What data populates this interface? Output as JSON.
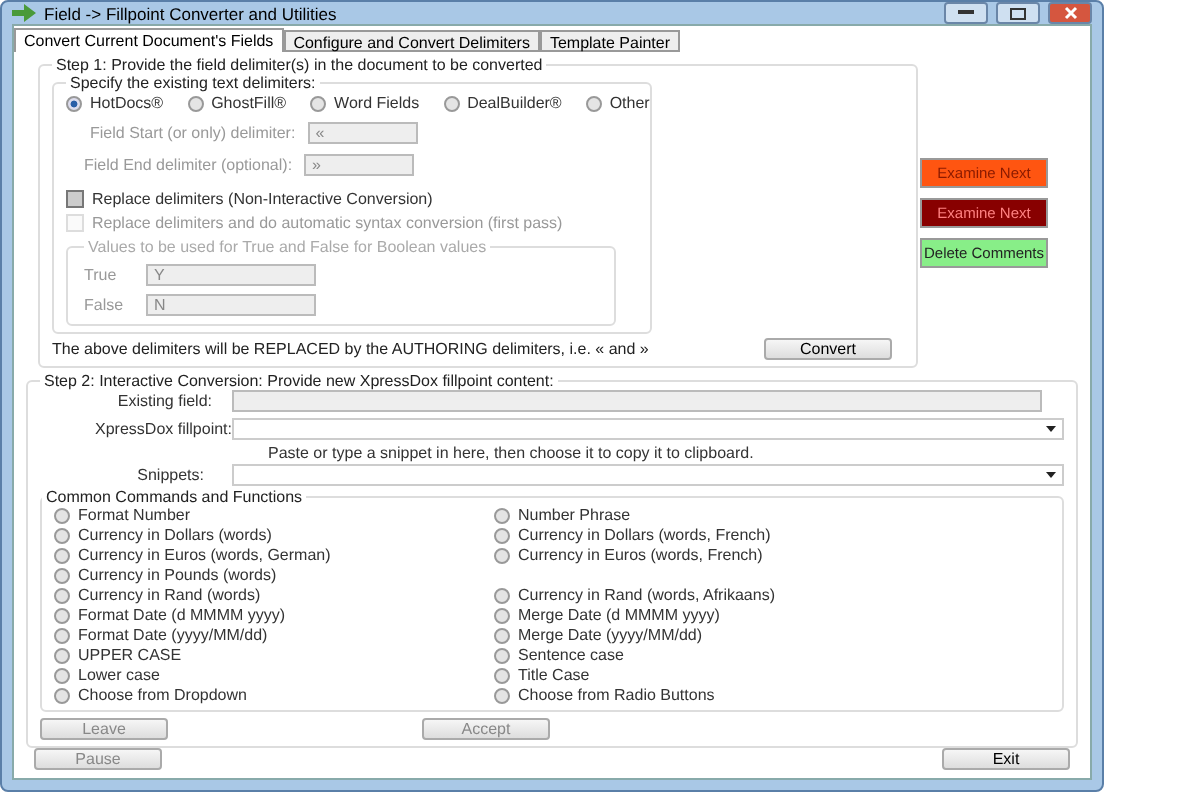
{
  "window": {
    "title": "Field -> Fillpoint Converter and Utilities"
  },
  "tabs": [
    {
      "label": "Convert Current Document's Fields",
      "selected": true
    },
    {
      "label": "Configure and Convert Delimiters",
      "selected": false
    },
    {
      "label": "Template Painter",
      "selected": false
    }
  ],
  "step1": {
    "legend": "Step 1: Provide the field delimiter(s) in the document to be converted",
    "delimiters": {
      "legend": "Specify the existing text delimiters:",
      "options": [
        {
          "label": "HotDocs®",
          "selected": true
        },
        {
          "label": "GhostFill®",
          "selected": false
        },
        {
          "label": "Word Fields",
          "selected": false
        },
        {
          "label": "DealBuilder®",
          "selected": false
        },
        {
          "label": "Other",
          "selected": false
        }
      ],
      "fields": [
        {
          "label": "Field Start (or only) delimiter:",
          "value": "«"
        },
        {
          "label": "Field End delimiter (optional):",
          "value": "»"
        }
      ]
    },
    "checkboxes": [
      {
        "label": "Replace delimiters (Non-Interactive Conversion)",
        "checked": false,
        "disabled": false
      },
      {
        "label": "Replace delimiters and do automatic syntax conversion (first pass)",
        "checked": false,
        "disabled": true
      }
    ],
    "booleans": {
      "legend": "Values to be used for True and False for Boolean values",
      "fields": [
        {
          "label": "True",
          "value": "Y"
        },
        {
          "label": "False",
          "value": "N"
        }
      ]
    },
    "note": "The above delimiters will be REPLACED by the AUTHORING delimiters, i.e. « and »",
    "convert": "Convert",
    "side_buttons": [
      {
        "label": "Examine Next",
        "color": "#ff5511"
      },
      {
        "label": "Examine Next",
        "color": "#880000"
      },
      {
        "label": "Delete Comments",
        "color": "#88ee88"
      }
    ]
  },
  "step2": {
    "legend": "Step 2: Interactive Conversion: Provide new XpressDox fillpoint content:",
    "existing_label": "Existing field:",
    "fillpoint_label": "XpressDox fillpoint:",
    "hint": "Paste or type a snippet in here, then choose it to copy it to clipboard.",
    "snippets_label": "Snippets:",
    "commands": {
      "legend": "Common Commands and Functions",
      "rows": [
        {
          "left": {
            "label": "Format Number",
            "selected": false
          },
          "right": {
            "label": "Number Phrase",
            "selected": false
          }
        },
        {
          "left": {
            "label": "Currency  in Dollars (words)",
            "selected": false
          },
          "right": {
            "label": "Currency in Dollars (words, French)",
            "selected": false
          }
        },
        {
          "left": {
            "label": "Currency  in Euros (words, German)",
            "selected": false
          },
          "right": {
            "label": "Currency in Euros (words, French)",
            "selected": false
          }
        },
        {
          "left": {
            "label": "Currency  in Pounds (words)",
            "selected": false
          }
        },
        {
          "left": {
            "label": "Currency in Rand (words)",
            "selected": false
          },
          "right": {
            "label": "Currency in Rand (words, Afrikaans)",
            "selected": false
          }
        },
        {
          "left": {
            "label": "Format Date (d MMMM yyyy)",
            "selected": false
          },
          "right": {
            "label": "Merge Date (d MMMM yyyy)",
            "selected": false
          }
        },
        {
          "left": {
            "label": "Format Date (yyyy/MM/dd)",
            "selected": false
          },
          "right": {
            "label": "Merge Date (yyyy/MM/dd)",
            "selected": false
          }
        },
        {
          "left": {
            "label": "UPPER CASE",
            "selected": false
          },
          "right": {
            "label": "Sentence case",
            "selected": false
          }
        },
        {
          "left": {
            "label": "Lower case",
            "selected": false
          },
          "right": {
            "label": "Title Case",
            "selected": false
          }
        },
        {
          "left": {
            "label": "Choose from Dropdown",
            "selected": false
          },
          "right": {
            "label": "Choose from Radio Buttons",
            "selected": false
          }
        }
      ]
    },
    "leave": "Leave",
    "accept": "Accept"
  },
  "footer": {
    "pause": "Pause",
    "exit": "Exit"
  }
}
